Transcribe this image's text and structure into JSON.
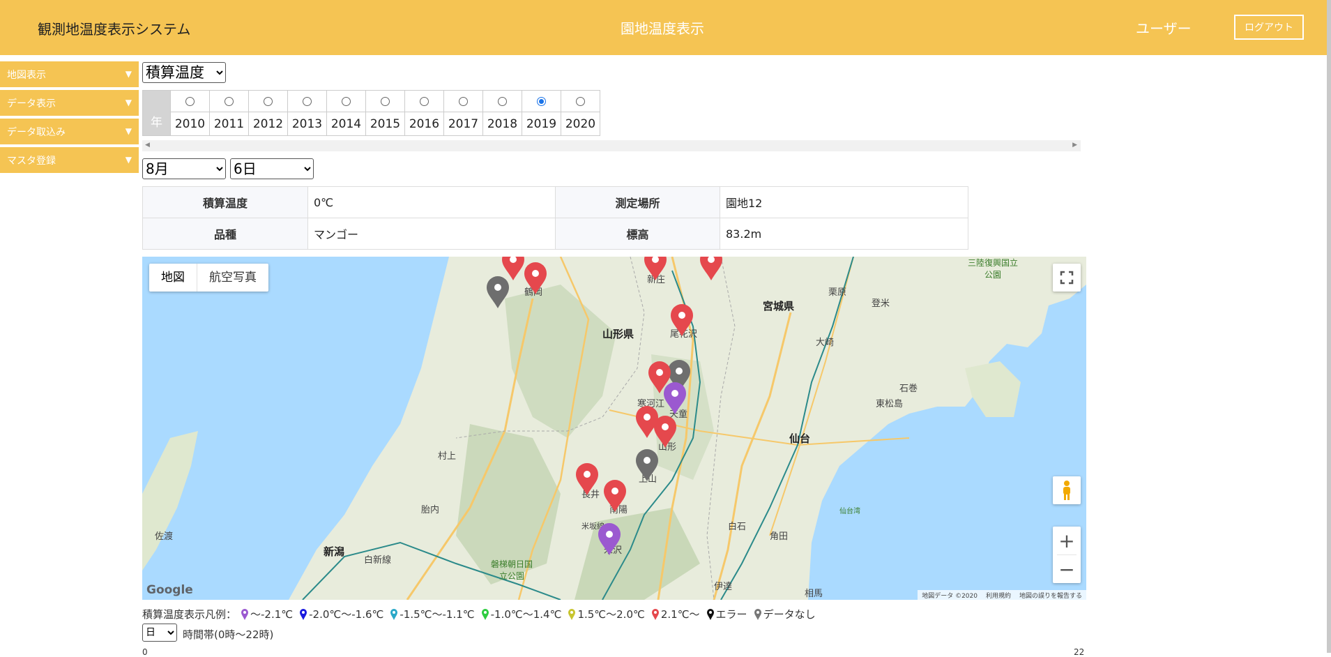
{
  "header": {
    "app_title": "観測地温度表示システム",
    "page_title": "園地温度表示",
    "user_label": "ユーザー",
    "logout_label": "ログアウト"
  },
  "sidebar": {
    "items": [
      {
        "label": "地図表示"
      },
      {
        "label": "データ表示"
      },
      {
        "label": "データ取込み"
      },
      {
        "label": "マスタ登録"
      }
    ]
  },
  "filters": {
    "type_selected": "積算温度",
    "month_selected": "8月",
    "day_selected": "6日",
    "period_selected": "日",
    "period_label": "時間帯(0時～22時)",
    "range_min": "0",
    "range_max": "22"
  },
  "year_table": {
    "head": "年",
    "years": [
      "2010",
      "2011",
      "2012",
      "2013",
      "2014",
      "2015",
      "2016",
      "2017",
      "2018",
      "2019",
      "2020"
    ],
    "selected": "2019"
  },
  "info": {
    "label_total": "積算温度",
    "value_total": "0℃",
    "label_location": "測定場所",
    "value_location": "園地12",
    "label_variety": "品種",
    "value_variety": "マンゴー",
    "label_altitude": "標高",
    "value_altitude": "83.2m"
  },
  "map": {
    "type_map": "地図",
    "type_aerial": "航空写真",
    "google": "Google",
    "attribution": [
      "地図データ ©2020",
      "利用規約",
      "地図の誤りを報告する"
    ],
    "labels": {
      "yamagata_pref": "山形県",
      "miyagi_pref": "宮城県",
      "sendai": "仙台",
      "niigata": "新潟",
      "shinjo": "新庄",
      "tsuruoka": "鶴岡",
      "obanazawa": "尾花沢",
      "sagae": "寒河江",
      "tendo": "天童",
      "yamagata_city": "山形",
      "kaminoyama": "上山",
      "nagai": "長井",
      "nanyo": "南陽",
      "yonezawa": "米沢",
      "murakami": "村上",
      "tainai": "胎内",
      "shibata": "白新線",
      "sado": "佐渡",
      "osaki": "大崎",
      "kurihara": "栗原",
      "tome": "登米",
      "ishinomaki": "石巻",
      "higashimatsushima": "東松島",
      "shiroishi": "白石",
      "kakuda": "角田",
      "date": "伊達",
      "soma": "相馬",
      "sanriku_park": "三陸復興国立公園",
      "bandai_park": "磐梯朝日国立公園",
      "sendai_bay": "仙台湾",
      "yonesaka_line": "米坂線"
    }
  },
  "legend": {
    "title": "積算温度表示凡例：",
    "items": [
      {
        "label": "～-2.1℃",
        "color": "#9b59d0"
      },
      {
        "label": "-2.0℃～-1.6℃",
        "color": "#1a1adf"
      },
      {
        "label": "-1.5℃～-1.1℃",
        "color": "#2aa8c8"
      },
      {
        "label": "-1.0℃～1.4℃",
        "color": "#2ecc40"
      },
      {
        "label": "1.5℃～2.0℃",
        "color": "#c8c530"
      },
      {
        "label": "2.1℃～",
        "color": "#e5484d"
      },
      {
        "label": "エラー",
        "color": "#111111"
      },
      {
        "label": "データなし",
        "color": "#777777"
      }
    ]
  },
  "colors": {
    "brand": "#f5c453",
    "pin_red": "#e5484d",
    "pin_gray": "#6e6e6e",
    "pin_purple": "#9b59d0",
    "sea": "#aadaff",
    "land": "#e8ecdc"
  }
}
